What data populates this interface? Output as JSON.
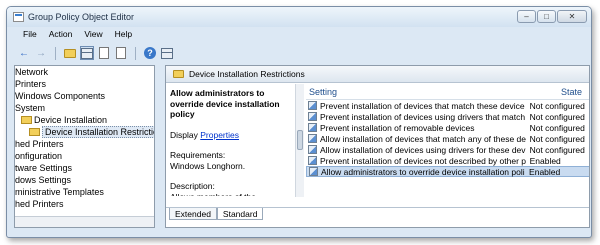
{
  "window": {
    "title": "Group Policy Object Editor"
  },
  "menu": [
    "File",
    "Action",
    "View",
    "Help"
  ],
  "tree": [
    {
      "label": "Network",
      "indent": 0
    },
    {
      "label": "Printers",
      "indent": 0
    },
    {
      "label": "Windows Components",
      "indent": 0
    },
    {
      "label": "System",
      "indent": 0
    },
    {
      "label": "Device Installation",
      "indent": 1
    },
    {
      "label": "Device Installation Restrictions",
      "indent": 2,
      "selected": true
    },
    {
      "label": "hed Printers",
      "indent": 0
    },
    {
      "label": "onfiguration",
      "indent": 0
    },
    {
      "label": "tware Settings",
      "indent": 0
    },
    {
      "label": "dows Settings",
      "indent": 0
    },
    {
      "label": "ministrative Templates",
      "indent": 0
    },
    {
      "label": "hed Printers",
      "indent": 0
    }
  ],
  "right": {
    "header": "Device Installation Restrictions",
    "description": {
      "title": "Allow administrators to override device installation policy",
      "display_label": "Display",
      "properties_link": "Properties",
      "requirements": "Requirements:\nWindows Longhorn.",
      "desc": "Description:\nAllows members of the"
    },
    "columns": {
      "setting": "Setting",
      "state": "State"
    },
    "rows": [
      {
        "setting": "Prevent installation of devices that match these device IDs",
        "state": "Not configured"
      },
      {
        "setting": "Prevent installation of devices using drivers that match these device setup classes",
        "state": "Not configured"
      },
      {
        "setting": "Prevent installation of removable devices",
        "state": "Not configured"
      },
      {
        "setting": "Allow installation of devices that match any of these device IDs",
        "state": "Not configured"
      },
      {
        "setting": "Allow installation of devices using drivers for these device classes",
        "state": "Not configured"
      },
      {
        "setting": "Prevent installation of devices not described by other policy settings",
        "state": "Enabled"
      },
      {
        "setting": "Allow administrators to override device installation policy",
        "state": "Enabled",
        "selected": true
      }
    ],
    "tabs": [
      "Extended",
      "Standard"
    ]
  }
}
